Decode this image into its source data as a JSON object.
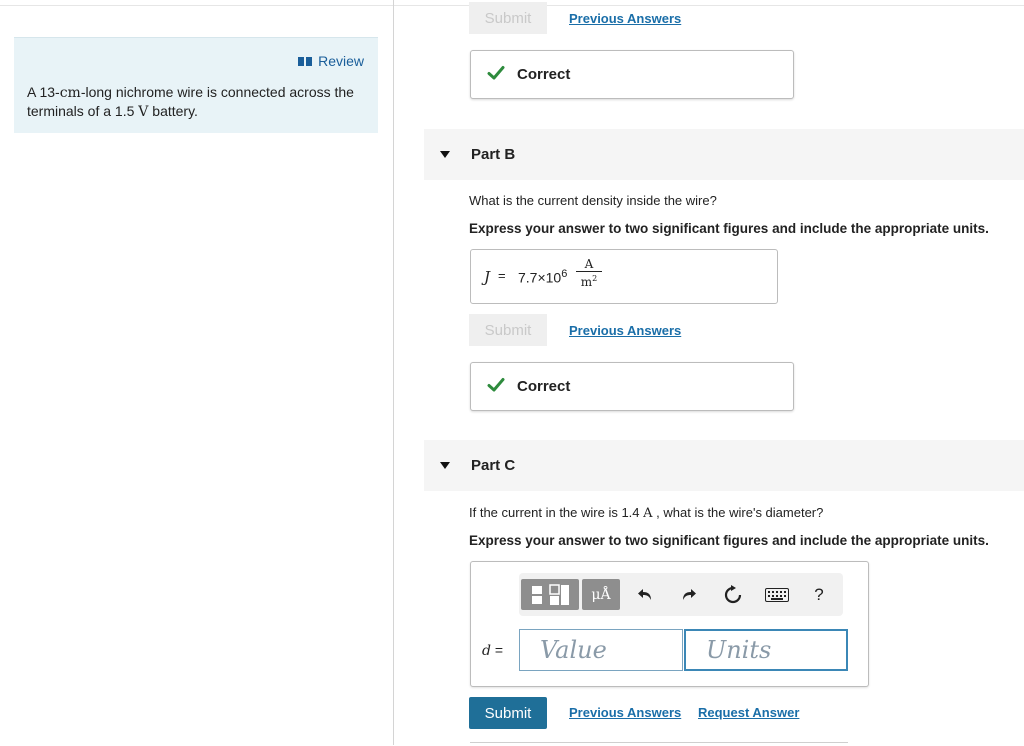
{
  "review": {
    "link_label": "Review",
    "problem_prefix": "A 13-",
    "problem_unit_cm": "cm",
    "problem_mid": "-long nichrome wire is connected across the terminals of a 1.5 ",
    "problem_unit_v": "V",
    "problem_suffix": " battery."
  },
  "part_a": {
    "submit_label": "Submit",
    "previous_answers_label": "Previous Answers",
    "feedback_label": "Correct"
  },
  "part_b": {
    "title": "Part B",
    "question": "What is the current density inside the wire?",
    "instruction": "Express your answer to two significant figures and include the appropriate units.",
    "answer_var": "J",
    "answer_eq": "=",
    "answer_mantissa": "7.7×10",
    "answer_exponent": "6",
    "answer_unit_num": "A",
    "answer_unit_den": "m",
    "answer_unit_den_exp": "2",
    "submit_label": "Submit",
    "previous_answers_label": "Previous Answers",
    "feedback_label": "Correct"
  },
  "part_c": {
    "title": "Part C",
    "question_prefix": "If the current in the wire is 1.4 ",
    "question_unit": "A",
    "question_suffix": " , what is the wire's diameter?",
    "instruction": "Express your answer to two significant figures and include the appropriate units.",
    "var_label": "d",
    "eq": "=",
    "value_placeholder": "Value",
    "units_placeholder": "Units",
    "units_tool_label": "μÅ",
    "help_label": "?",
    "submit_label": "Submit",
    "previous_answers_label": "Previous Answers",
    "request_answer_label": "Request Answer"
  },
  "colors": {
    "accent": "#1f6f98",
    "link": "#1a6ea8",
    "correct_check": "#2e8b3d",
    "review_bg": "#e8f3f7"
  }
}
